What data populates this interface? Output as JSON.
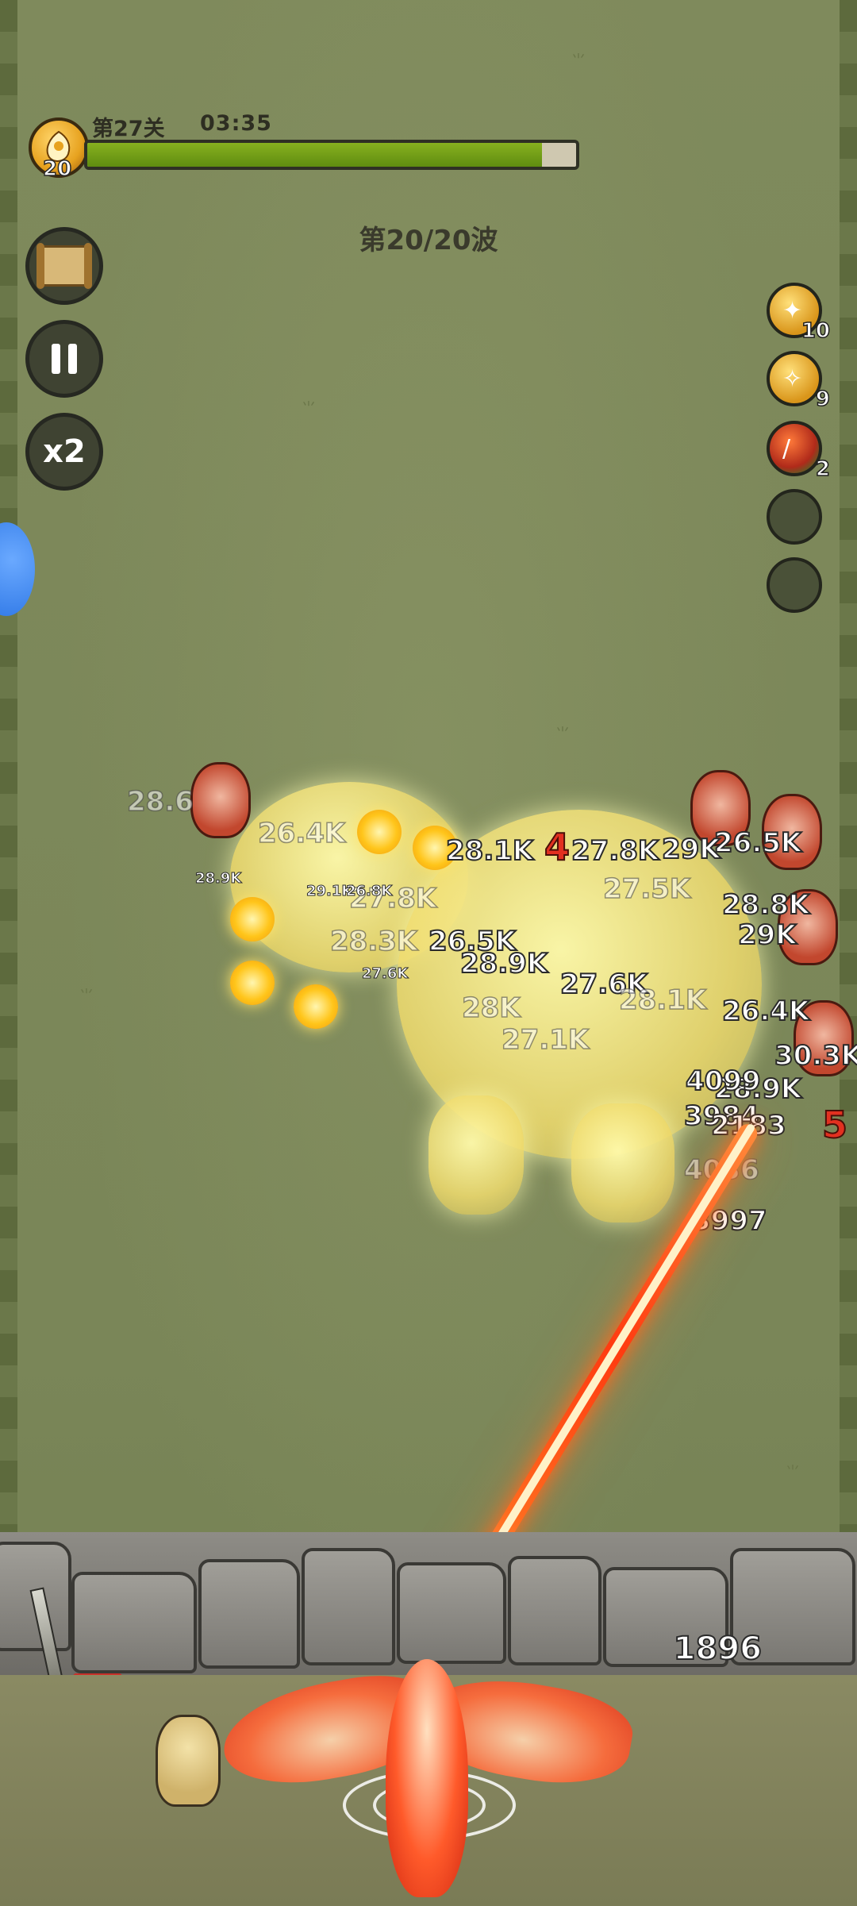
{
  "hud": {
    "stage": "第27关",
    "timer": "03:35",
    "level": "20",
    "progress": 0.93,
    "wave": "第20/20波"
  },
  "left_buttons": {
    "map_icon": "scroll-map-icon",
    "pause_icon": "pause-icon",
    "speed_label": "x2"
  },
  "skills": [
    {
      "icon": "sparrow-icon",
      "count": "10",
      "style": "gold"
    },
    {
      "icon": "bird-icon",
      "count": "9",
      "style": "gold"
    },
    {
      "icon": "fire-blade-icon",
      "count": "2",
      "style": "red"
    },
    {
      "icon": "empty-slot",
      "count": "",
      "style": "empty"
    },
    {
      "icon": "empty-slot",
      "count": "",
      "style": "empty"
    }
  ],
  "damage_numbers": [
    {
      "text": "28.6",
      "style": "faded"
    },
    {
      "text": "26.4K",
      "style": "faded"
    },
    {
      "text": "28.1K",
      "style": "normal"
    },
    {
      "text": "27.8K",
      "style": "normal"
    },
    {
      "text": "29K",
      "style": "normal"
    },
    {
      "text": "26.5K",
      "style": "normal"
    },
    {
      "text": "27.8K",
      "style": "faded"
    },
    {
      "text": "27.5K",
      "style": "faded"
    },
    {
      "text": "28.3K",
      "style": "faded"
    },
    {
      "text": "26.5K",
      "style": "normal"
    },
    {
      "text": "28.9K",
      "style": "normal"
    },
    {
      "text": "27.6K",
      "style": "normal"
    },
    {
      "text": "28.8K",
      "style": "normal"
    },
    {
      "text": "29K",
      "style": "normal"
    },
    {
      "text": "28K",
      "style": "faded"
    },
    {
      "text": "27.1K",
      "style": "faded"
    },
    {
      "text": "28.1K",
      "style": "faded"
    },
    {
      "text": "26.4K",
      "style": "normal"
    },
    {
      "text": "30.3K",
      "style": "normal"
    },
    {
      "text": "28.9K",
      "style": "normal"
    },
    {
      "text": "4099",
      "style": "normal"
    },
    {
      "text": "3984",
      "style": "normal"
    },
    {
      "text": "2183",
      "style": "normal"
    },
    {
      "text": "4036",
      "style": "faded"
    },
    {
      "text": "3997",
      "style": "normal"
    },
    {
      "text": "4",
      "style": "red"
    },
    {
      "text": "5",
      "style": "red"
    },
    {
      "text": "29.1K",
      "style": "small"
    },
    {
      "text": "26.8K",
      "style": "small"
    },
    {
      "text": "28.9K",
      "style": "small"
    },
    {
      "text": "27.6K",
      "style": "small"
    }
  ],
  "wall": {
    "hp": "1896",
    "hp_fraction": 0.26
  }
}
